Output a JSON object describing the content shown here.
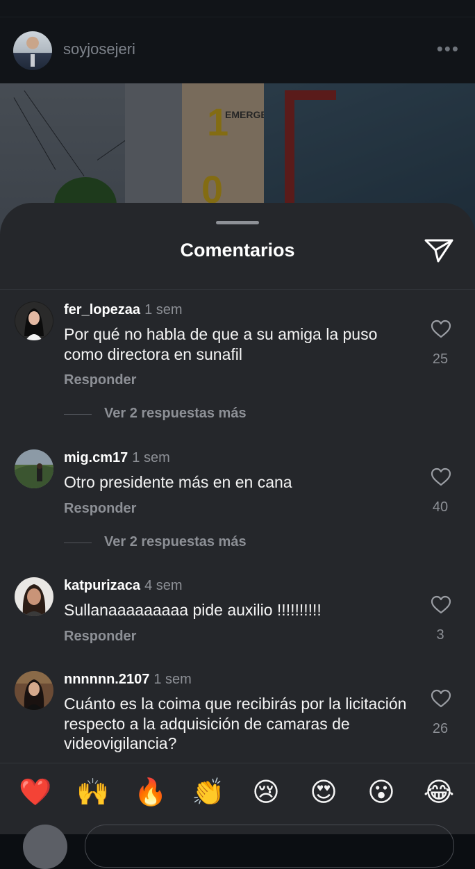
{
  "post": {
    "username": "soyjosejeri",
    "more_icon": "more-horizontal-icon",
    "sign_number_top": "1",
    "sign_number_bottom": "0",
    "sign_letters": "EMERGE"
  },
  "comments_sheet": {
    "title": "Comentarios",
    "share_icon": "send-icon",
    "comments": [
      {
        "username": "fer_lopezaa",
        "time": "1 sem",
        "text": "Por qué no habla de que a su amiga la puso como directora en sunafil",
        "reply_label": "Responder",
        "likes": "25",
        "view_replies": "Ver 2 respuestas más"
      },
      {
        "username": "mig.cm17",
        "time": "1 sem",
        "text": "Otro presidente más en en cana",
        "reply_label": "Responder",
        "likes": "40",
        "view_replies": "Ver 2 respuestas más"
      },
      {
        "username": "katpurizaca",
        "time": "4 sem",
        "text": "Sullanaaaaaaaaa pide auxilio !!!!!!!!!!",
        "reply_label": "Responder",
        "likes": "3"
      },
      {
        "username": "nnnnnn.2107",
        "time": "1 sem",
        "text": "Cuánto es la coima que recibirás por la licitación respecto a la adquisición de camaras de videovigilancia?",
        "likes": "26"
      }
    ]
  },
  "emoji_bar": {
    "emojis": [
      "❤️",
      "🙌",
      "🔥",
      "👏",
      "😢",
      "😍",
      "😮",
      "😂"
    ]
  },
  "colors": {
    "sheet_background": "#25272b",
    "primary_text": "#f4f4f4",
    "secondary_text": "#8d9096"
  }
}
